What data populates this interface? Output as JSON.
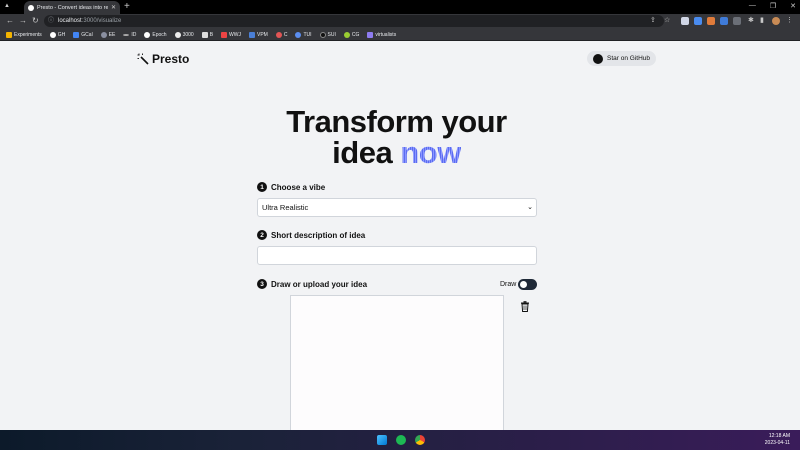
{
  "browser": {
    "tab_title": "Presto - Convert ideas into realis",
    "url_host": "localhost",
    "url_path": ":3000/visualize",
    "bookmarks": [
      "Experiments",
      "GH",
      "GCal",
      "EE",
      "ID",
      "Epoch",
      "3000",
      "B",
      "WWJ",
      "VPM",
      "C",
      "TUI",
      "SUI",
      "CG",
      "virtualists"
    ]
  },
  "header": {
    "logo_text": "Presto",
    "github_button": "Star on GitHub"
  },
  "hero": {
    "line1": "Transform your",
    "line2_a": "idea",
    "line2_b": "now"
  },
  "steps": [
    {
      "num": "1",
      "label": "Choose a vibe"
    },
    {
      "num": "2",
      "label": "Short description of idea"
    },
    {
      "num": "3",
      "label": "Draw or upload your idea"
    }
  ],
  "vibe_select": {
    "value": "Ultra Realistic"
  },
  "description_input": {
    "value": "",
    "placeholder": ""
  },
  "draw_toggle": {
    "label": "Draw",
    "on": true
  },
  "taskbar": {
    "time": "12:18 AM",
    "date": "2023-04-11"
  }
}
